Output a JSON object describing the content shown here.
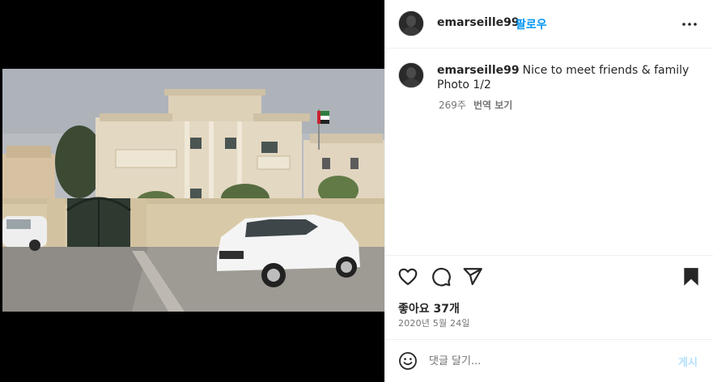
{
  "post": {
    "username": "emarseille99",
    "separator": "•",
    "follow_label": "팔로우",
    "more_icon": "more-horizontal-icon"
  },
  "caption": {
    "username": "emarseille99",
    "text": "Nice to meet friends & family Photo 1/2",
    "age": "269주",
    "translate_label": "번역 보기"
  },
  "actions": {
    "like_icon": "heart-icon",
    "comment_icon": "comment-icon",
    "share_icon": "send-icon",
    "save_icon": "bookmark-icon"
  },
  "stats": {
    "likes": "좋아요 37개",
    "date": "2020년 5월 24일"
  },
  "comment": {
    "placeholder": "댓글 달기...",
    "post_label": "게시",
    "emoji_icon": "emoji-icon"
  },
  "colors": {
    "accent": "#0095f6",
    "muted": "#737373",
    "post_disabled": "#b2dffc"
  }
}
